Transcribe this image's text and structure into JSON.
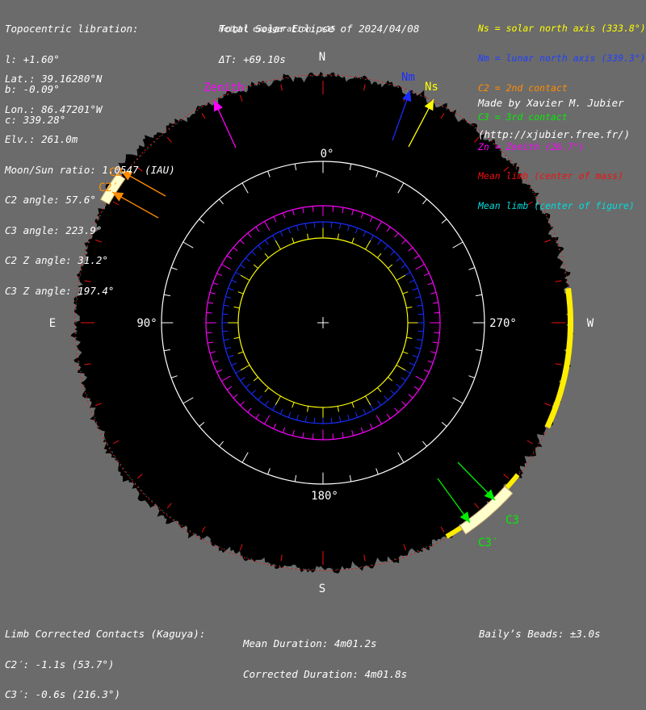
{
  "header_left": {
    "title": "Topocentric libration:",
    "lines": [
      "l: +1.60°",
      "b: -0.09°",
      "c: 339.28°"
    ]
  },
  "observer": {
    "lines": [
      "Lat.: 39.16280°N",
      "Lon.: 86.47201°W",
      "Elv.: 261.0m",
      "Moon/Sun ratio: 1.0547 (IAU)",
      "C2 angle: 57.6°",
      "C3 angle: 223.9°",
      "C2 Z angle: 31.2°",
      "C3 Z angle: 197.4°"
    ]
  },
  "header_center": {
    "title": "Total Solar Eclipse of 2024/04/08",
    "delta_t": "ΔT: +69.10s",
    "exaggeration": "Height exaggeration: x15"
  },
  "legend": {
    "items": [
      {
        "text": "Ns = solar north axis (333.8°)",
        "color": "#ffff00"
      },
      {
        "text": "Nm = lunar north axis (339.3°)",
        "color": "#2040ff"
      },
      {
        "text": "C2 = 2nd contact",
        "color": "#ff8c00"
      },
      {
        "text": "C3 = 3rd contact",
        "color": "#00ee00"
      },
      {
        "text": "Zn = Zenith (26.7°)",
        "color": "#ff00ff"
      },
      {
        "text": "Mean limb (center of mass)",
        "color": "#ee1111"
      },
      {
        "text": "Mean limb (center of figure)",
        "color": "#00dddd"
      }
    ]
  },
  "credit": [
    "Made by Xavier M. Jubier",
    "(http://xjubier.free.fr/)"
  ],
  "diagram": {
    "cardinal": {
      "north": "N",
      "south": "S",
      "east": "E",
      "west": "W"
    },
    "angles": {
      "top": "0°",
      "left": "90°",
      "bottom": "180°",
      "right": "270°"
    },
    "markers": {
      "zenith": "Zenith",
      "nm": "Nm",
      "ns": "Ns",
      "c2": "C2",
      "c2p": "C2′",
      "c3": "C3",
      "c3p": "C3′"
    },
    "colors": {
      "background": "#6b6b6b",
      "disk": "#000000",
      "zenith": "#ff00ff",
      "lunar_axis": "#1a2cff",
      "solar_axis": "#ffff00",
      "c2": "#ff8c00",
      "c3": "#00ee00",
      "mass_limb": "#ee1111",
      "figure_limb": "#00dddd",
      "beads": "#ffffcc"
    }
  },
  "footer": {
    "title": "Limb Corrected Contacts (Kaguya):",
    "c2p": "C2′: -1.1s (53.7°)",
    "c3p": "C3′: -0.6s (216.3°)",
    "mean_duration": "Mean Duration: 4m01.2s",
    "corrected_duration": "Corrected Duration: 4m01.8s",
    "beads": "Baily’s Beads: ±3.0s"
  }
}
